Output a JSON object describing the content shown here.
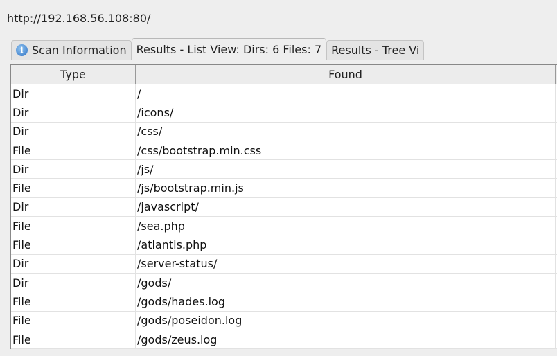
{
  "url": "http://192.168.56.108:80/",
  "tabs": [
    {
      "label": "Scan Information",
      "icon": "info-icon"
    },
    {
      "label": "Results - List View: Dirs: 6 Files: 7"
    },
    {
      "label": "Results - Tree Vi"
    }
  ],
  "table": {
    "headers": [
      "Type",
      "Found"
    ],
    "rows": [
      [
        "Dir",
        "/"
      ],
      [
        "Dir",
        "/icons/"
      ],
      [
        "Dir",
        "/css/"
      ],
      [
        "File",
        "/css/bootstrap.min.css"
      ],
      [
        "Dir",
        "/js/"
      ],
      [
        "File",
        "/js/bootstrap.min.js"
      ],
      [
        "Dir",
        "/javascript/"
      ],
      [
        "File",
        "/sea.php"
      ],
      [
        "File",
        "/atlantis.php"
      ],
      [
        "Dir",
        "/server-status/"
      ],
      [
        "Dir",
        "/gods/"
      ],
      [
        "File",
        "/gods/hades.log"
      ],
      [
        "File",
        "/gods/poseidon.log"
      ],
      [
        "File",
        "/gods/zeus.log"
      ]
    ]
  }
}
